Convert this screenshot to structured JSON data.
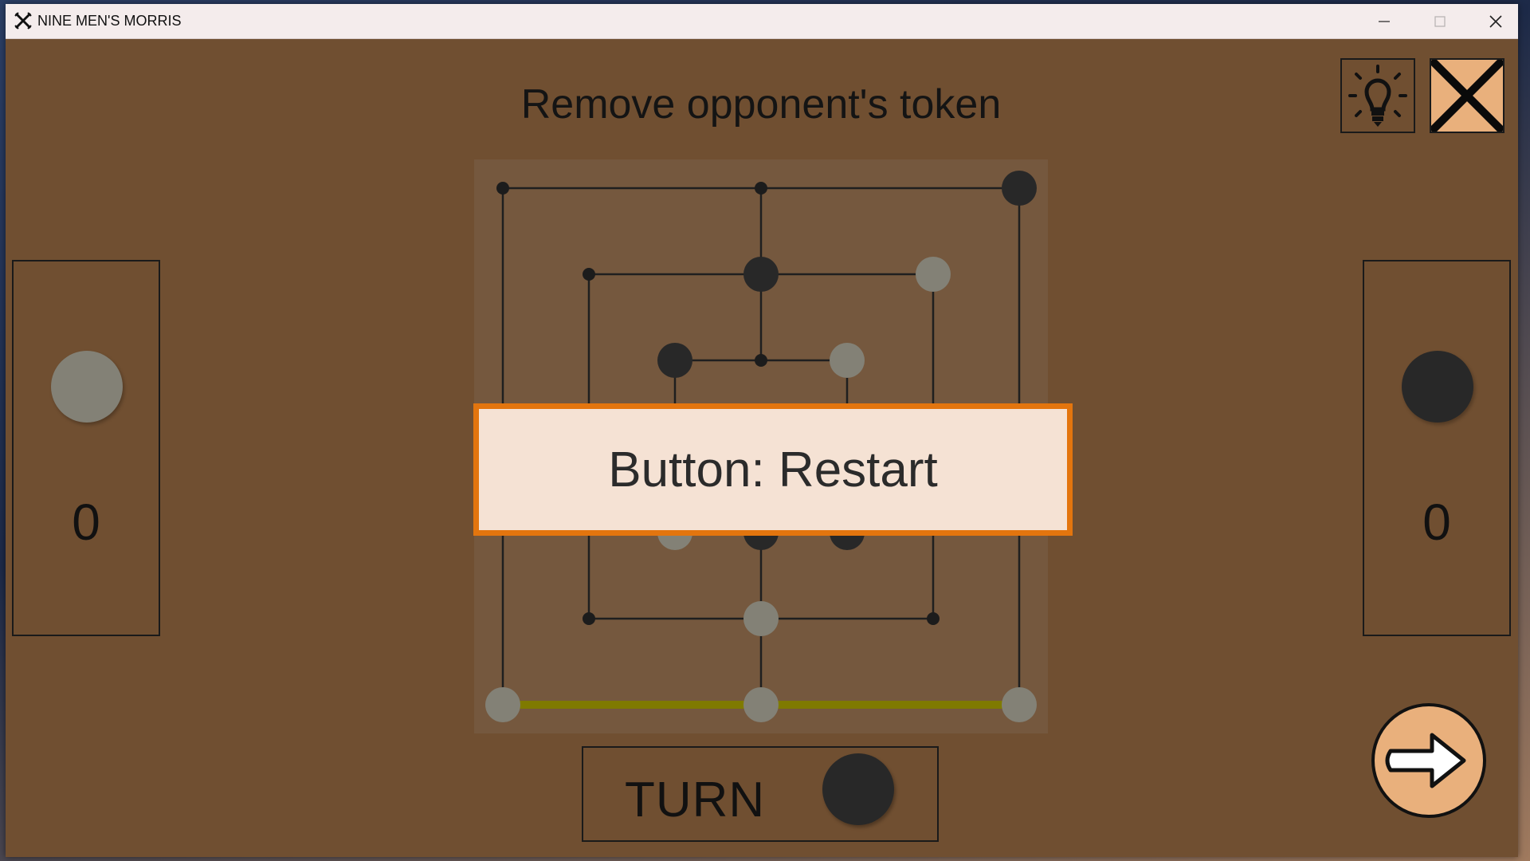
{
  "window": {
    "title": "NINE MEN'S MORRIS",
    "controls": [
      "minimize",
      "maximize",
      "close"
    ]
  },
  "status_message": "Remove opponent's token",
  "toolbar": {
    "hint_icon": "lightbulb-icon",
    "close_icon": "close-x-icon"
  },
  "left_player": {
    "token_color": "gray",
    "count": "0"
  },
  "right_player": {
    "token_color": "black",
    "count": "0"
  },
  "turn": {
    "label": "TURN",
    "current_color": "black"
  },
  "next_button": {
    "icon": "arrow-right-icon"
  },
  "tooltip": {
    "text": "Button: Restart"
  },
  "board": {
    "points": [
      {
        "pos": "a7",
        "state": "empty"
      },
      {
        "pos": "d7",
        "state": "empty"
      },
      {
        "pos": "g7",
        "state": "black"
      },
      {
        "pos": "b6",
        "state": "empty"
      },
      {
        "pos": "d6",
        "state": "black"
      },
      {
        "pos": "f6",
        "state": "gray"
      },
      {
        "pos": "c5",
        "state": "black"
      },
      {
        "pos": "d5",
        "state": "empty"
      },
      {
        "pos": "e5",
        "state": "gray"
      },
      {
        "pos": "a4",
        "state": "hidden"
      },
      {
        "pos": "b4",
        "state": "hidden"
      },
      {
        "pos": "c4",
        "state": "hidden"
      },
      {
        "pos": "e4",
        "state": "hidden"
      },
      {
        "pos": "f4",
        "state": "hidden"
      },
      {
        "pos": "g4",
        "state": "hidden"
      },
      {
        "pos": "c3",
        "state": "gray"
      },
      {
        "pos": "d3",
        "state": "black"
      },
      {
        "pos": "e3",
        "state": "black"
      },
      {
        "pos": "b2",
        "state": "empty"
      },
      {
        "pos": "d2",
        "state": "gray"
      },
      {
        "pos": "f2",
        "state": "empty"
      },
      {
        "pos": "a1",
        "state": "gray"
      },
      {
        "pos": "d1",
        "state": "gray"
      },
      {
        "pos": "g1",
        "state": "gray"
      }
    ],
    "highlighted_mill": [
      "a1",
      "d1",
      "g1"
    ]
  },
  "colors": {
    "background": "#704f31",
    "board": "#75583e",
    "black_token": "#282828",
    "gray_token": "#838176",
    "mill_highlight": "#7f7a00",
    "tooltip_border": "#e3750e",
    "tooltip_bg": "#f5e2d4",
    "button_bg": "#e9b07c"
  }
}
